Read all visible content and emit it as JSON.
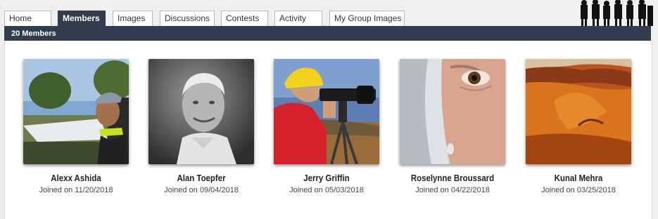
{
  "tabs": [
    {
      "label": "Home",
      "active": false
    },
    {
      "label": "Members",
      "active": true
    },
    {
      "label": "Images",
      "active": false
    },
    {
      "label": "Discussions",
      "active": false
    },
    {
      "label": "Contests",
      "active": false
    },
    {
      "label": "Activity",
      "active": false
    },
    {
      "label": "My Group Images",
      "active": false
    }
  ],
  "header": {
    "count_label": "20 Members"
  },
  "members": [
    {
      "name": "Alexx Ashida",
      "joined": "Joined on 11/20/2018",
      "photo": "man-outdoors-selfie-photo"
    },
    {
      "name": "Alan Toepfer",
      "joined": "Joined on 09/04/2018",
      "photo": "black-and-white-portrait-photo"
    },
    {
      "name": "Jerry Griffin",
      "joined": "Joined on 05/03/2018",
      "photo": "photographer-with-camera-photo"
    },
    {
      "name": "Roselynne Broussard",
      "joined": "Joined on 04/22/2018",
      "photo": "woman-closeup-photo"
    },
    {
      "name": "Kunal Mehra",
      "joined": "Joined on 03/25/2018",
      "photo": "desert-dunes-photo"
    }
  ],
  "colors": {
    "nav_bar": "#323d50",
    "page_bg": "#efefef",
    "panel_bg": "#ffffff"
  }
}
